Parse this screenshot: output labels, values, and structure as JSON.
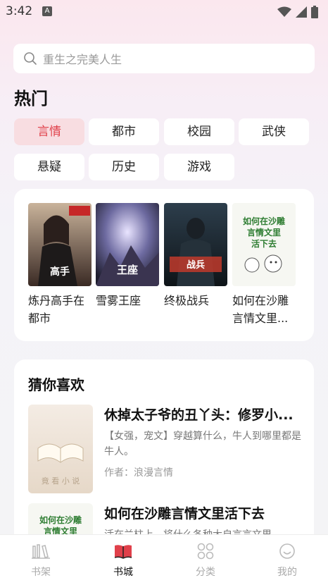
{
  "status_bar": {
    "time": "3:42",
    "app_icon": "A"
  },
  "search": {
    "placeholder": "重生之完美人生"
  },
  "hot": {
    "title": "热门",
    "tags": [
      "言情",
      "都市",
      "校园",
      "武侠",
      "悬疑",
      "历史",
      "游戏"
    ],
    "active_tag": "言情"
  },
  "books": [
    {
      "title": "炼丹高手在都市",
      "cover_text": "炼丹高手在都市"
    },
    {
      "title": "雪雾王座",
      "cover_text": "雪雾王座"
    },
    {
      "title": "终极战兵",
      "cover_text": "终极战兵"
    },
    {
      "title": "如何在沙雕言情文里...",
      "cover_text": "如何在沙雕言情文里活下去"
    }
  ],
  "recommend": {
    "heading": "猜你喜欢",
    "items": [
      {
        "title": "休掉太子爷的丑丫头：修罗小...",
        "desc": "【女强，宠文】穿越算什么，牛人到哪里都是牛人。",
        "author_label": "作者：",
        "author": "浪漫言情",
        "cover_text": "竟 看 小 说"
      },
      {
        "title": "如何在沙雕言情文里活下去",
        "desc": "活在兰柱上，将什么各种大自言言文里",
        "cover_text": "如何在沙雕言情文里"
      }
    ]
  },
  "nav": {
    "items": [
      {
        "label": "书架",
        "icon": "bookshelf-icon"
      },
      {
        "label": "书城",
        "icon": "bookstore-icon"
      },
      {
        "label": "分类",
        "icon": "category-icon"
      },
      {
        "label": "我的",
        "icon": "profile-icon"
      }
    ],
    "active": "书城"
  },
  "colors": {
    "accent": "#e0404a",
    "active_tag_bg": "#f8dde1"
  }
}
